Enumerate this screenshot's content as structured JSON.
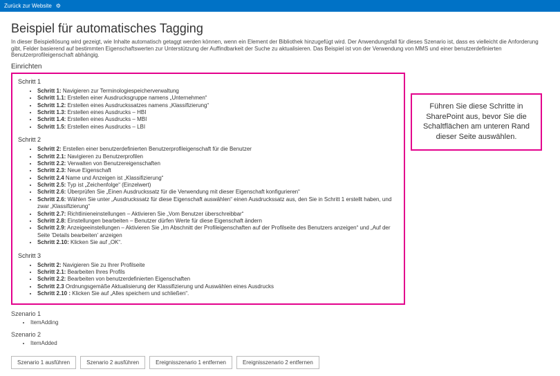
{
  "topbar": {
    "back_label": "Zurück zur Website",
    "gear_glyph": "⚙"
  },
  "page": {
    "title": "Beispiel für automatisches Tagging",
    "intro": "In dieser Beispiellösung wird gezeigt, wie Inhalte automatisch getaggt werden können, wenn ein Element der Bibliothek hinzugefügt wird. Der Anwendungsfall für dieses Szenario ist, dass es vielleicht die Anforderung gibt, Felder basierend auf bestimmten Eigenschaftswerten zur Unterstützung der Auffindbarkeit der Suche zu aktualisieren. Das Beispiel ist von der Verwendung von MMS und einer benutzerdefinierten Benutzerprofileigenschaft abhängig."
  },
  "setup": {
    "heading": "Einrichten",
    "groups": [
      {
        "title": "Schritt 1",
        "items": [
          {
            "label": "Schritt 1:",
            "text": "Navigieren zur Terminologiespeicherverwaltung"
          },
          {
            "label": "Schritt 1.1:",
            "text": "Erstellen einer Ausdrucksgruppe namens „Unternehmen“"
          },
          {
            "label": "Schritt 1.2:",
            "text": "Erstellen eines Ausdruckssatzes namens „Klassifizierung“"
          },
          {
            "label": "Schritt 1.3:",
            "text": "Erstellen eines Ausdrucks – HBI"
          },
          {
            "label": "Schritt 1.4:",
            "text": "Erstellen eines Ausdrucks – MBI"
          },
          {
            "label": "Schritt 1.5:",
            "text": "Erstellen eines Ausdrucks – LBI"
          }
        ]
      },
      {
        "title": "Schritt 2",
        "items": [
          {
            "label": "Schritt 2:",
            "text": "Erstellen einer benutzerdefinierten Benutzerprofileigenschaft für die Benutzer"
          },
          {
            "label": "Schritt 2.1:",
            "text": "Navigieren zu Benutzerprofilen"
          },
          {
            "label": "Schritt 2.2:",
            "text": "Verwalten von Benutzereigenschaften"
          },
          {
            "label": "Schritt 2.3:",
            "text": "Neue Eigenschaft"
          },
          {
            "label": "Schritt 2.4",
            "text": "Name und Anzeigen ist „Klassifizierung“"
          },
          {
            "label": "Schritt 2.5:",
            "text": "Typ ist „Zeichenfolge“ (Einzelwert)"
          },
          {
            "label": "Schritt 2.6:",
            "text": "Überprüfen Sie „Einen Ausdruckssatz für die Verwendung mit dieser Eigenschaft konfigurieren“"
          },
          {
            "label": "Schritt 2.6:",
            "text": "Wählen Sie unter „Ausdruckssatz für diese Eigenschaft auswählen“ einen Ausdruckssatz aus, den Sie in Schritt 1 erstellt haben, und zwar „Klassifizierung“"
          },
          {
            "label": "Schritt 2.7:",
            "text": "Richtlinieneinstellungen – Aktivieren Sie „Vom Benutzer überschreibbar“"
          },
          {
            "label": "Schritt 2.8:",
            "text": "Einstellungen bearbeiten – Benutzer dürfen Werte für diese Eigenschaft ändern"
          },
          {
            "label": "Schritt 2.9:",
            "text": "Anzeigeeinstellungen – Aktivieren Sie „Im Abschnitt der Profileigenschaften auf der Profilseite des Benutzers anzeigen“ und „Auf der Seite 'Details bearbeiten' anzeigen"
          },
          {
            "label": "Schritt 2.10:",
            "text": "Klicken Sie auf „OK“."
          }
        ]
      },
      {
        "title": "Schritt 3",
        "items": [
          {
            "label": "Schritt 2:",
            "text": "Navigieren Sie zu Ihrer Profilseite"
          },
          {
            "label": "Schritt 2.1:",
            "text": "Bearbeiten Ihres Profils"
          },
          {
            "label": "Schritt 2.2:",
            "text": "Bearbeiten von benutzerdefinierten Eigenschaften"
          },
          {
            "label": "Schritt 2.3",
            "text": "Ordnungsgemäße Aktualisierung der Klassifizierung und Auswählen eines Ausdrucks"
          },
          {
            "label": "Schritt 2.10 :",
            "text": "Klicken Sie auf „Alles speichern und schließen“."
          }
        ]
      }
    ]
  },
  "callout": {
    "text": "Führen Sie diese Schritte in SharePoint aus, bevor Sie die Schaltflächen am unteren Rand dieser Seite auswählen."
  },
  "scenarios": [
    {
      "title": "Szenario 1",
      "items": [
        "ItemAdding"
      ]
    },
    {
      "title": "Szenario 2",
      "items": [
        "ItemAdded"
      ]
    }
  ],
  "buttons": {
    "run1": "Szenario 1 ausführen",
    "run2": "Szenario 2 ausführen",
    "remove1": "Ereignisszenario 1 entfernen",
    "remove2": "Ereignisszenario 2 entfernen"
  },
  "colors": {
    "brand_blue": "#0072c6",
    "accent_pink": "#e3008c"
  }
}
